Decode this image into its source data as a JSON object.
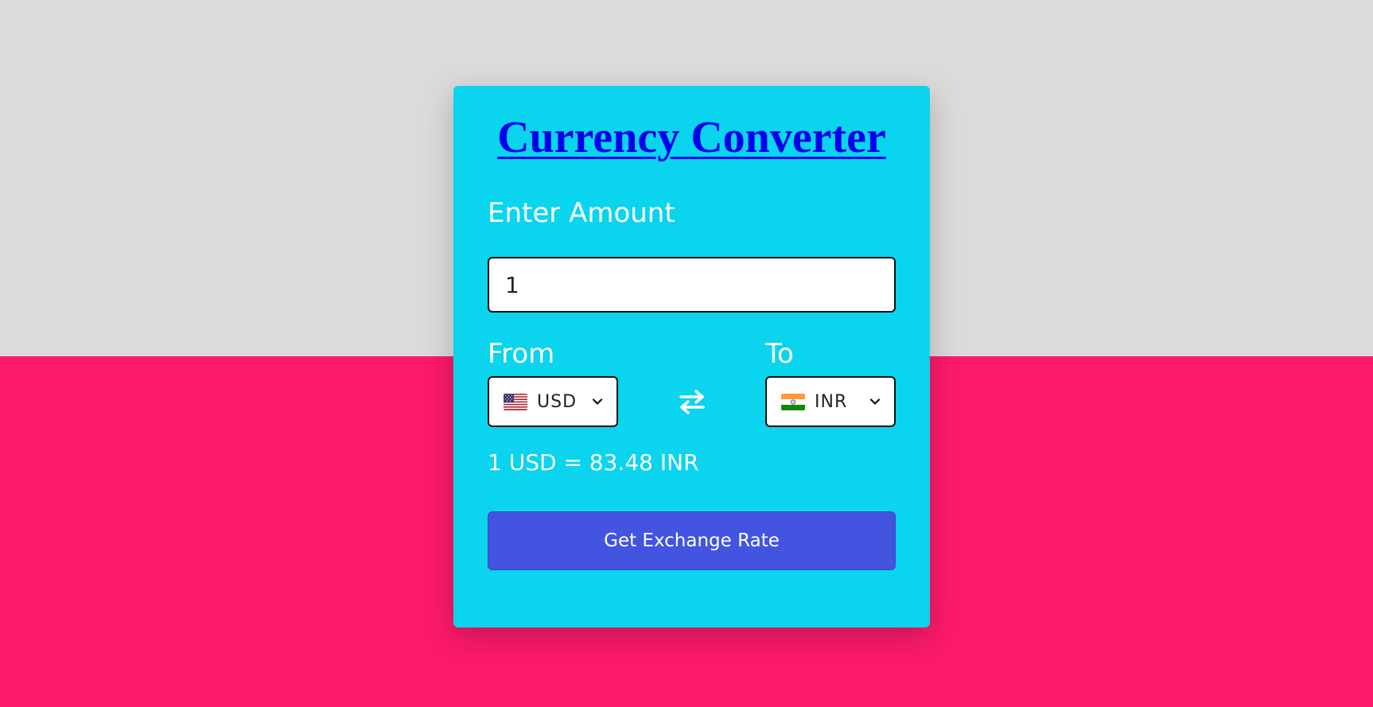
{
  "app": {
    "title": "Currency Converter"
  },
  "amount": {
    "label": "Enter Amount",
    "value": "1"
  },
  "from": {
    "label": "From",
    "code": "USD",
    "flag_icon": "us-flag-icon"
  },
  "to": {
    "label": "To",
    "code": "INR",
    "flag_icon": "india-flag-icon"
  },
  "swap": {
    "icon": "swap-arrows-icon"
  },
  "result": {
    "text": "1 USD = 83.48 INR"
  },
  "actions": {
    "submit_label": "Get Exchange Rate"
  },
  "colors": {
    "background_top": "#dcdadb",
    "background_bottom": "#fd1a6c",
    "card": "#0ad4ee",
    "button": "#4354e0",
    "title": "#0000ee"
  }
}
